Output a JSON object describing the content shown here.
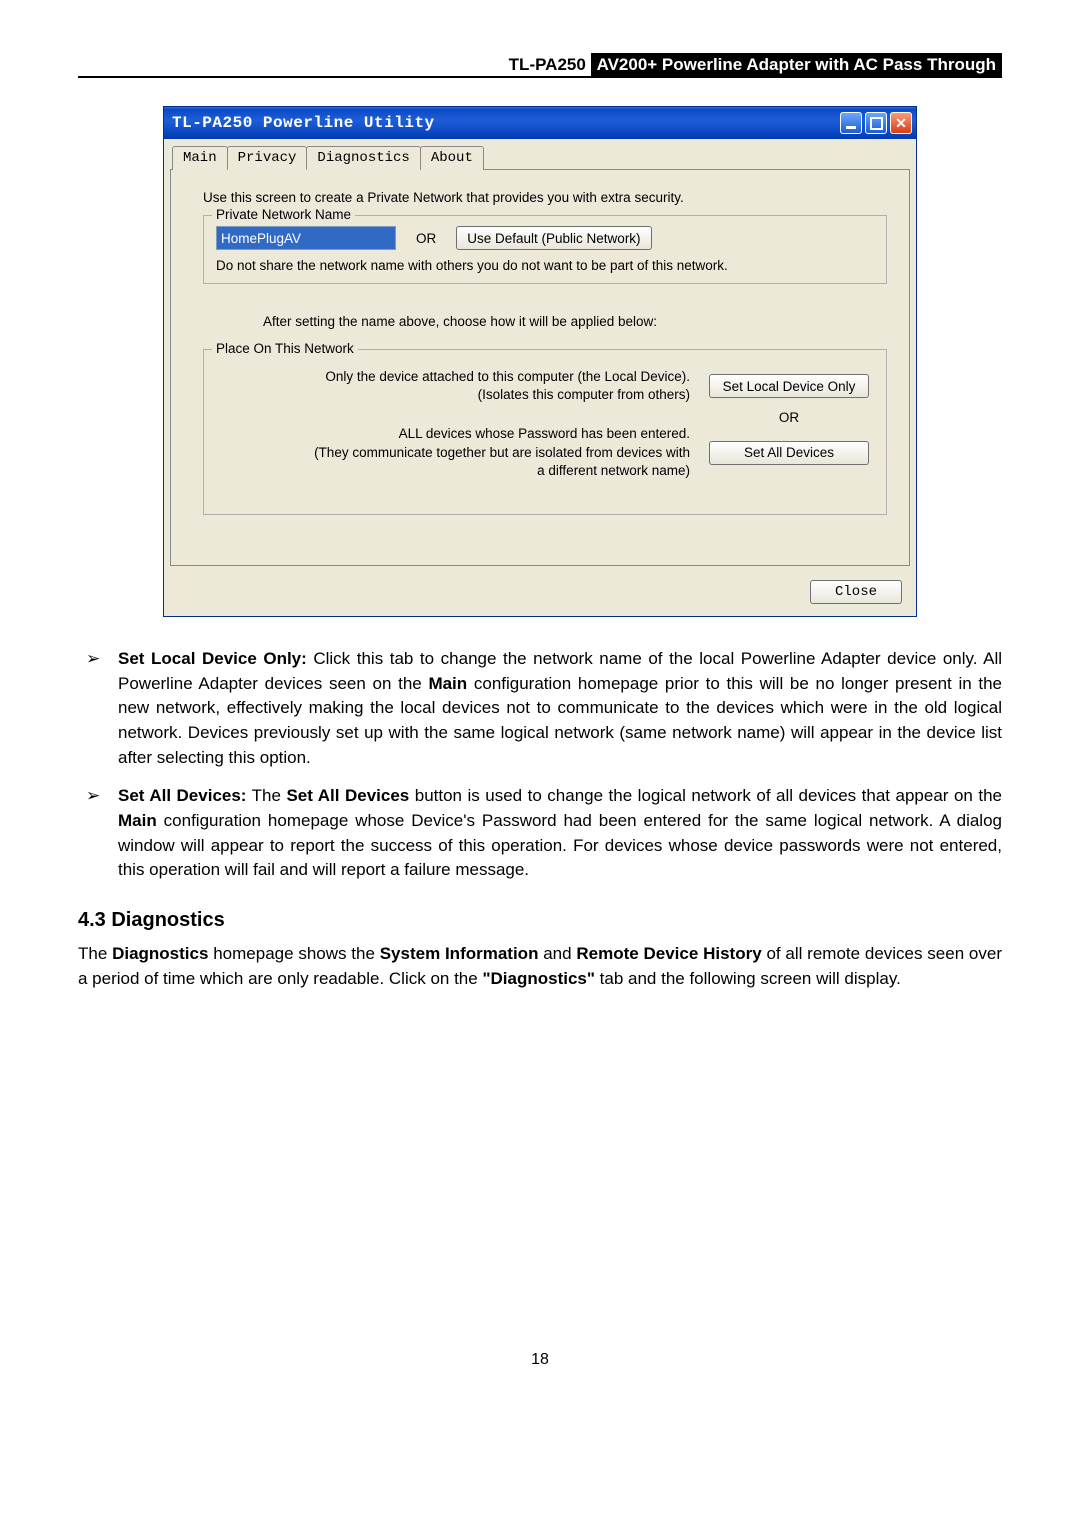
{
  "doc_header": {
    "model": "TL-PA250",
    "desc": " AV200+ Powerline Adapter with AC Pass Through"
  },
  "window": {
    "title": "TL-PA250 Powerline Utility",
    "tabs": {
      "main": "Main",
      "privacy": "Privacy",
      "diagnostics": "Diagnostics",
      "about": "About"
    },
    "intro": "Use this screen to create a Private Network that provides you with extra security.",
    "group1": {
      "legend": "Private Network Name",
      "input_value": "HomePlugAV",
      "or": "OR",
      "default_btn": "Use Default (Public Network)",
      "note": "Do not share the network name with others you do not want to be part of this network."
    },
    "mid": "After setting the name above, choose how it will be applied below:",
    "group2": {
      "legend": "Place On This Network",
      "local_text1": "Only the device attached to this computer (the Local Device).",
      "local_text2": "(Isolates this computer from others)",
      "local_btn": "Set Local Device Only",
      "or": "OR",
      "all_text1": "ALL devices whose Password has been entered.",
      "all_text2": "(They communicate together but are isolated from devices with",
      "all_text3": "a different network name)",
      "all_btn": "Set All Devices"
    },
    "close": "Close"
  },
  "body": {
    "b1_label": "Set Local Device Only:",
    "b1_text_a": " Click this tab to change the network name of the local Powerline Adapter device only. All Powerline Adapter devices seen on the ",
    "b1_main": "Main",
    "b1_text_b": " configuration homepage prior to this will be no longer present in the new network, effectively making the local devices not to communicate to the devices which were in the old logical network. Devices previously set up with the same logical network (same network name) will appear in the device list after selecting this option.",
    "b2_label": "Set All Devices:",
    "b2_text_a": " The ",
    "b2_bold1": "Set All Devices",
    "b2_text_b": " button is used to change the logical network of all devices that appear on the ",
    "b2_bold2": "Main",
    "b2_text_c": " configuration homepage whose Device's Password had been entered for the same logical network. A dialog window will appear to report the success of this operation. For devices whose device passwords were not entered, this operation will fail and will report a failure message.",
    "h3": "4.3 Diagnostics",
    "p_a": "The ",
    "p_b1": "Diagnostics",
    "p_b": " homepage shows the ",
    "p_b2": "System Information",
    "p_c": " and ",
    "p_b3": "Remote Device History",
    "p_d": " of all remote devices seen over a period of time which are only readable. Click on the ",
    "p_b4": "\"Diagnostics\"",
    "p_e": " tab and the following screen will display.",
    "page": "18"
  }
}
